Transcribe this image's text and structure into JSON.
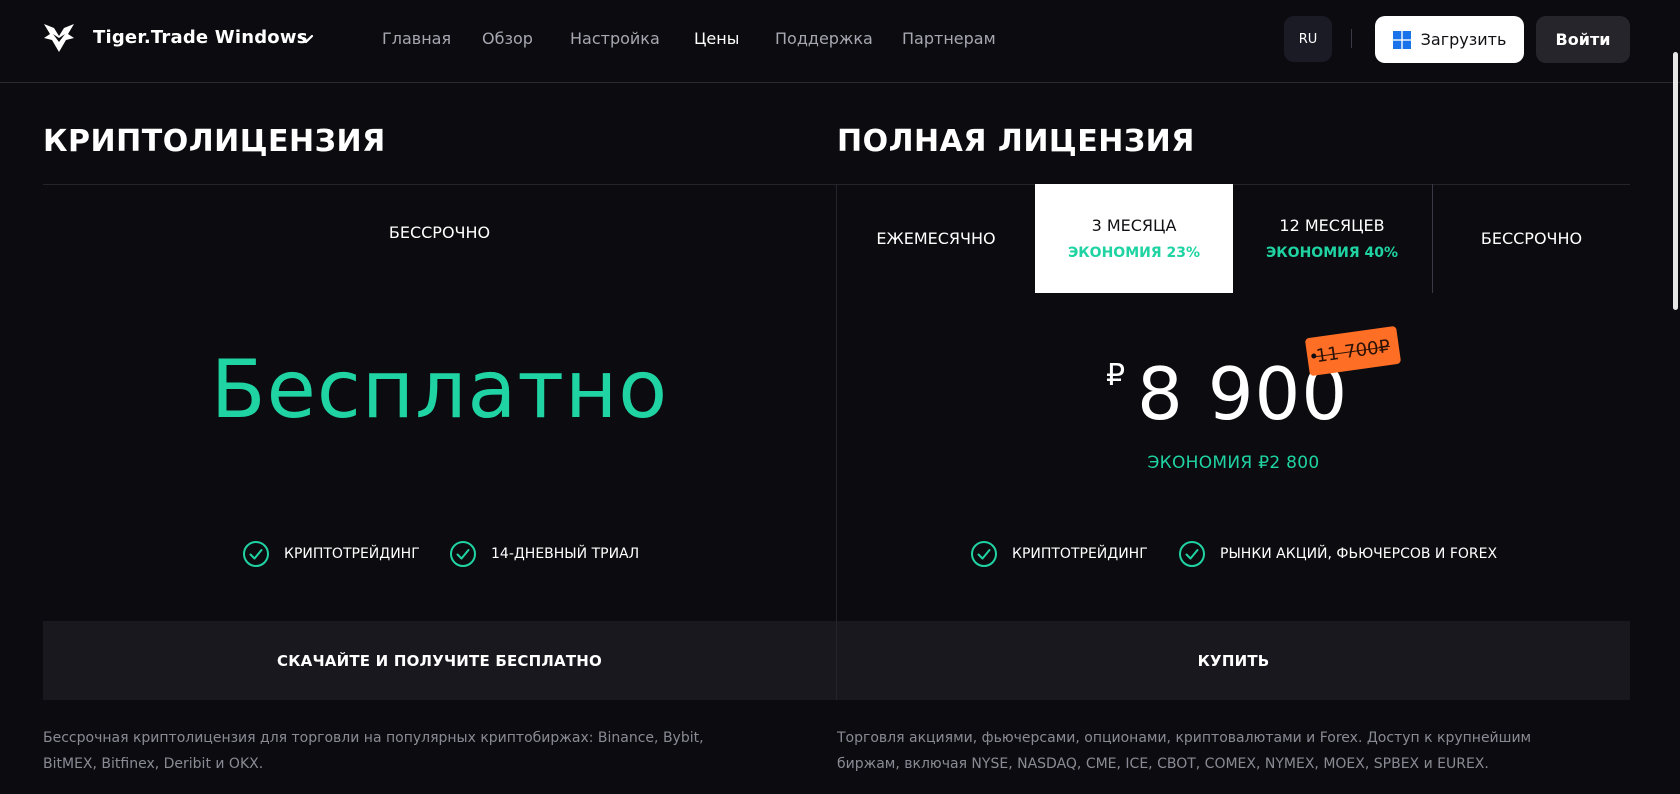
{
  "navbar": {
    "brand": "Tiger.Trade Windows",
    "links": [
      {
        "label": "Главная",
        "active": false
      },
      {
        "label": "Обзор",
        "active": false
      },
      {
        "label": "Настройка",
        "active": false
      },
      {
        "label": "Цены",
        "active": true
      },
      {
        "label": "Поддержка",
        "active": false
      },
      {
        "label": "Партнерам",
        "active": false
      }
    ],
    "language": "RU",
    "download_label": "Загрузить",
    "login_label": "Войти"
  },
  "crypto": {
    "title": "КРИПТОЛИЦЕНЗИЯ",
    "period": "БЕССРОЧНО",
    "price_text": "Бесплатно",
    "features": [
      "КРИПТОТРЕЙДИНГ",
      "14-ДНЕВНЫЙ ТРИАЛ"
    ],
    "cta": "СКАЧАЙТЕ И ПОЛУЧИТЕ БЕСПЛАТНО",
    "description_line1": "Бессрочная криптолицензия для торговли на популярных криптобиржах: Binance, Bybit,",
    "description_line2": "BitMEX, Bitfinex, Deribit и OKX."
  },
  "full": {
    "title": "ПОЛНАЯ ЛИЦЕНЗИЯ",
    "tabs": [
      {
        "label": "ЕЖЕМЕСЯЧНО",
        "sub": "",
        "active": false
      },
      {
        "label": "3 МЕСЯЦА",
        "sub": "ЭКОНОМИЯ 23%",
        "active": true
      },
      {
        "label": "12 МЕСЯЦЕВ",
        "sub": "ЭКОНОМИЯ 40%",
        "active": false
      },
      {
        "label": "БЕССРОЧНО",
        "sub": "",
        "active": false
      }
    ],
    "currency": "₽",
    "price": "8 900",
    "old_price": "11 700₽",
    "savings": "ЭКОНОМИЯ ₽2 800",
    "features": [
      "КРИПТОТРЕЙДИНГ",
      "РЫНКИ АКЦИЙ, ФЬЮЧЕРСОВ И FOREX"
    ],
    "cta": "КУПИТЬ",
    "description_line1": "Торговля акциями, фьючерсами, опционами, криптовалютами и Forex. Доступ к крупнейшим",
    "description_line2": "биржам, включая NYSE, NASDAQ, CME, ICE, CBOT, COMEX, NYMEX, MOEX, SPBEX и EUREX."
  },
  "colors": {
    "accent_green": "#1fd3a3",
    "tag_orange": "#ff6e25",
    "background": "#0c0c10"
  },
  "icons": [
    "tiger-logo-icon",
    "chevron-down-icon",
    "windows-icon",
    "check-circle-icon"
  ]
}
